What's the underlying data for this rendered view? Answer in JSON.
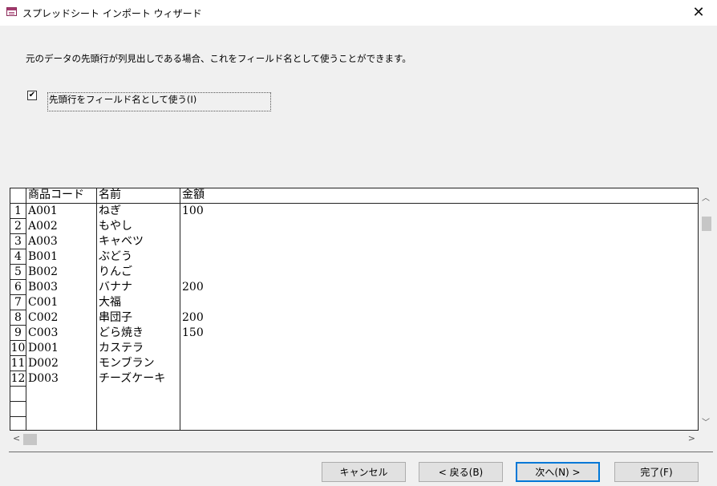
{
  "window": {
    "title": "スプレッドシート インポート ウィザード",
    "close_glyph": "✕"
  },
  "description": "元のデータの先頭行が列見出しである場合、これをフィールド名として使うことができます。",
  "first_row_checkbox": {
    "label": "先頭行をフィールド名として使う(I)",
    "checked": true
  },
  "table": {
    "columns": [
      "商品コード",
      "名前",
      "金額"
    ],
    "rows": [
      {
        "num": "1",
        "code": "A001",
        "name": "ねぎ",
        "price": "100"
      },
      {
        "num": "2",
        "code": "A002",
        "name": "もやし",
        "price": ""
      },
      {
        "num": "3",
        "code": "A003",
        "name": "キャベツ",
        "price": ""
      },
      {
        "num": "4",
        "code": "B001",
        "name": "ぶどう",
        "price": ""
      },
      {
        "num": "5",
        "code": "B002",
        "name": "りんご",
        "price": ""
      },
      {
        "num": "6",
        "code": "B003",
        "name": "バナナ",
        "price": "200"
      },
      {
        "num": "7",
        "code": "C001",
        "name": "大福",
        "price": ""
      },
      {
        "num": "8",
        "code": "C002",
        "name": "串団子",
        "price": "200"
      },
      {
        "num": "9",
        "code": "C003",
        "name": "どら焼き",
        "price": "150"
      },
      {
        "num": "10",
        "code": "D001",
        "name": "カステラ",
        "price": ""
      },
      {
        "num": "11",
        "code": "D002",
        "name": "モンブラン",
        "price": ""
      },
      {
        "num": "12",
        "code": "D003",
        "name": "チーズケーキ",
        "price": ""
      }
    ]
  },
  "buttons": {
    "cancel": "キャンセル",
    "back": "< 戻る(B)",
    "next": "次へ(N) >",
    "finish": "完了(F)"
  },
  "icons": [
    "app-icon",
    "close-icon",
    "checkbox-check-icon",
    "scroll-up-icon",
    "scroll-down-icon",
    "scroll-left-icon",
    "scroll-right-icon"
  ],
  "colors": {
    "background": "#f0f0f0",
    "default_button_border": "#0078d7",
    "app_icon": "#a33a6e"
  }
}
